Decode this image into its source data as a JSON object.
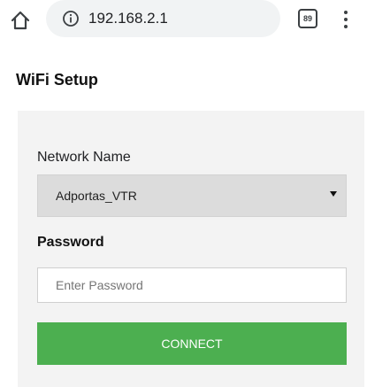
{
  "browser": {
    "url": "192.168.2.1",
    "tab_count": "89",
    "home_icon": "home-icon",
    "info_icon": "info-icon",
    "menu_icon": "vertical-dots-icon"
  },
  "page": {
    "title": "WiFi Setup"
  },
  "form": {
    "network_label": "Network Name",
    "network_selected": "Adportas_VTR",
    "password_label": "Password",
    "password_placeholder": "Enter Password",
    "connect_label": "CONNECT"
  },
  "colors": {
    "accent": "#4caf50",
    "card_bg": "#f3f3f3",
    "select_bg": "#dcdcdc",
    "url_bar_bg": "#f1f3f4"
  }
}
